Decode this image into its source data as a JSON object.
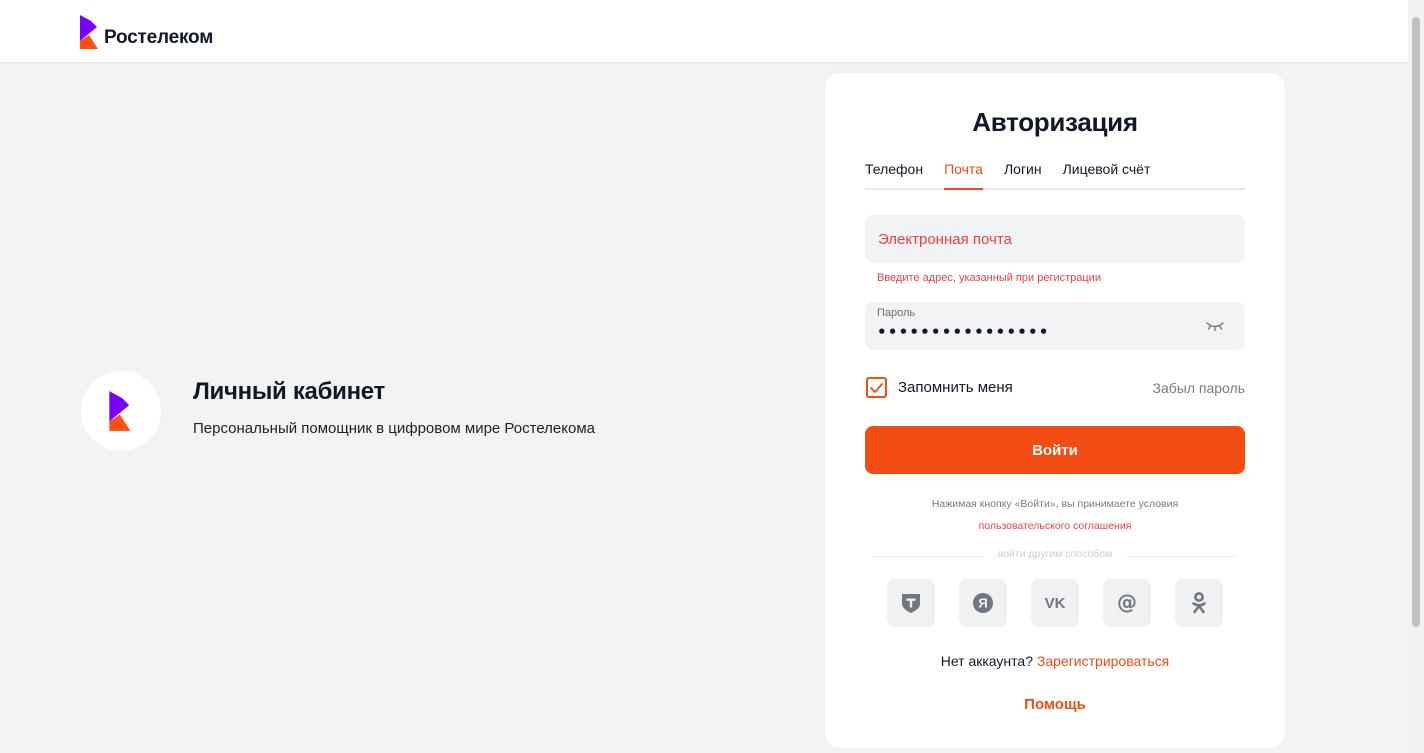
{
  "header": {
    "logo_text": "Ростелеком"
  },
  "promo": {
    "title": "Личный кабинет",
    "subtitle": "Персональный помощник в цифровом мире Ростелекома"
  },
  "auth": {
    "title": "Авторизация",
    "tabs": [
      {
        "label": "Телефон",
        "active": false
      },
      {
        "label": "Почта",
        "active": true
      },
      {
        "label": "Логин",
        "active": false
      },
      {
        "label": "Лицевой счёт",
        "active": false
      }
    ],
    "email": {
      "placeholder": "Электронная почта",
      "value": "",
      "error": "Введите адрес, указанный при регистрации"
    },
    "password": {
      "label": "Пароль",
      "value": "••••••••••••••••"
    },
    "remember_label": "Запомнить меня",
    "remember_checked": true,
    "forgot_label": "Забыл пароль",
    "login_button": "Войти",
    "terms_text": "Нажимая кнопку «Войти», вы принимаете условия",
    "terms_link": "пользовательского соглашения",
    "alt_login_text": "войти другим способом",
    "socials": [
      {
        "icon": "tinkoff-icon"
      },
      {
        "icon": "yandex-icon"
      },
      {
        "icon": "vk-icon"
      },
      {
        "icon": "mail-icon"
      },
      {
        "icon": "odnoklassniki-icon"
      }
    ],
    "no_account_text": "Нет аккаунта?",
    "register_link": "Зарегистрироваться",
    "help_label": "Помощь"
  },
  "colors": {
    "accent": "#f24c13",
    "logo_purple": "#7700ff",
    "logo_orange": "#ff4f12",
    "error": "#ef3e3e",
    "social_icon": "#6f7782"
  }
}
